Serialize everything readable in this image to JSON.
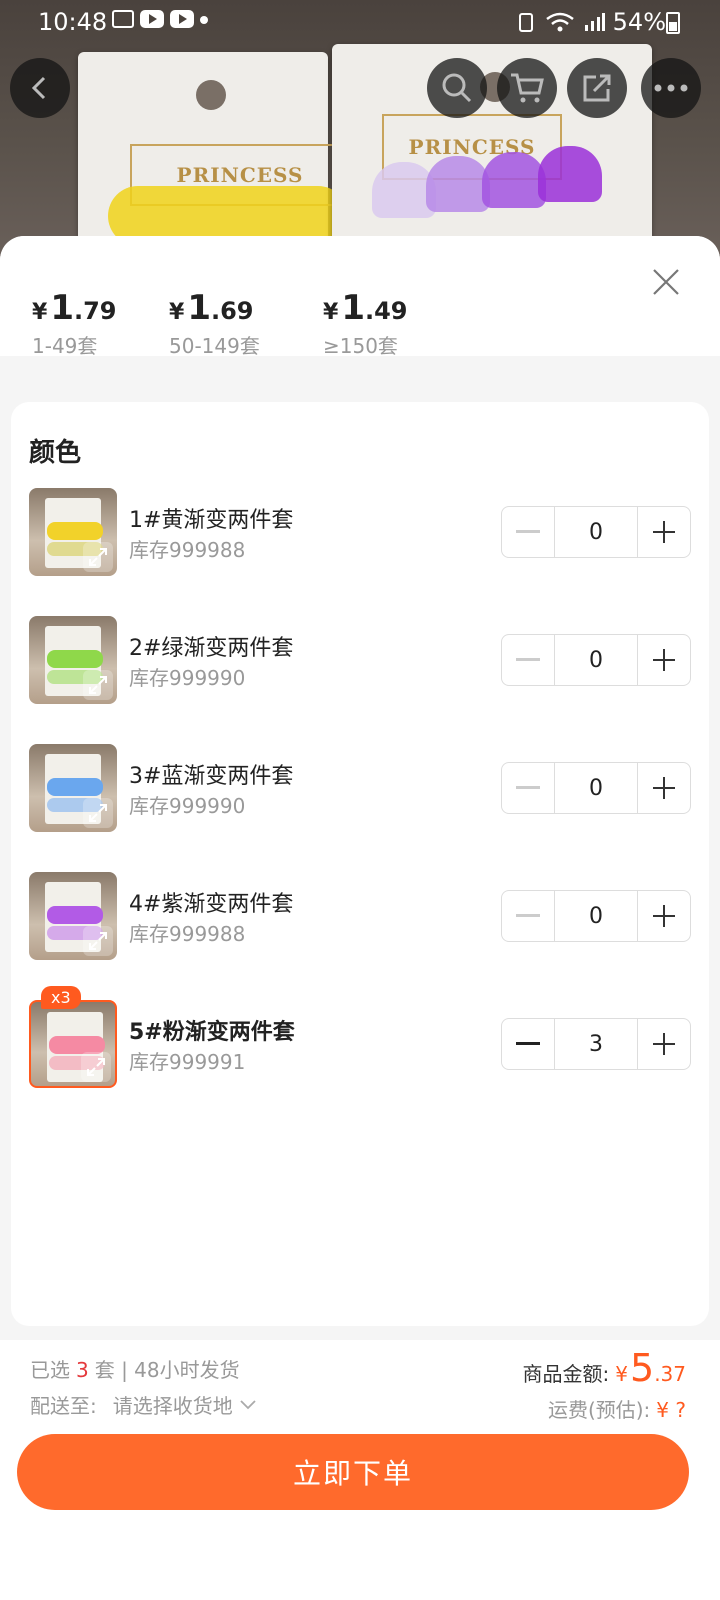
{
  "status_bar": {
    "time": "10:48",
    "battery": "54%"
  },
  "backdrop": {
    "card_label_1": "PRINCESS",
    "card_label_2": "PRINCESS"
  },
  "tiers": [
    {
      "yen": "¥",
      "int": "1",
      "dec": ".79",
      "range": "1-49套"
    },
    {
      "yen": "¥",
      "int": "1",
      "dec": ".69",
      "range": "50-149套"
    },
    {
      "yen": "¥",
      "int": "1",
      "dec": ".49",
      "range": "≥150套"
    }
  ],
  "section": {
    "title": "颜色"
  },
  "variants": [
    {
      "name": "1#黄渐变两件套",
      "stock": "库存999988",
      "qty": "0",
      "color": "#f2d22a",
      "color2": "#d9d06a"
    },
    {
      "name": "2#绿渐变两件套",
      "stock": "库存999990",
      "qty": "0",
      "color": "#8fd84a",
      "color2": "#a8de74"
    },
    {
      "name": "3#蓝渐变两件套",
      "stock": "库存999990",
      "qty": "0",
      "color": "#6aa7ee",
      "color2": "#8fb9f0"
    },
    {
      "name": "4#紫渐变两件套",
      "stock": "库存999988",
      "qty": "0",
      "color": "#b25be6",
      "color2": "#c98ce9"
    },
    {
      "name": "5#粉渐变两件套",
      "stock": "库存999991",
      "qty": "3",
      "badge": "x3",
      "color": "#f58aa3",
      "color2": "#f4a5b5"
    }
  ],
  "summary": {
    "selected_prefix": "已选",
    "selected_count": "3",
    "selected_suffix": "套 | 48小时发货",
    "deliver_label": "配送至:",
    "deliver_value": "请选择收货地",
    "amount_label": "商品金额:",
    "amount_yen": "¥",
    "amount_int": "5",
    "amount_dec": ".37",
    "shipping_label": "运费(预估):",
    "shipping_value": "¥ ?"
  },
  "order_button": "立即下单",
  "colors": {
    "accent": "#ff6a2c",
    "price": "#ff5a1f"
  }
}
